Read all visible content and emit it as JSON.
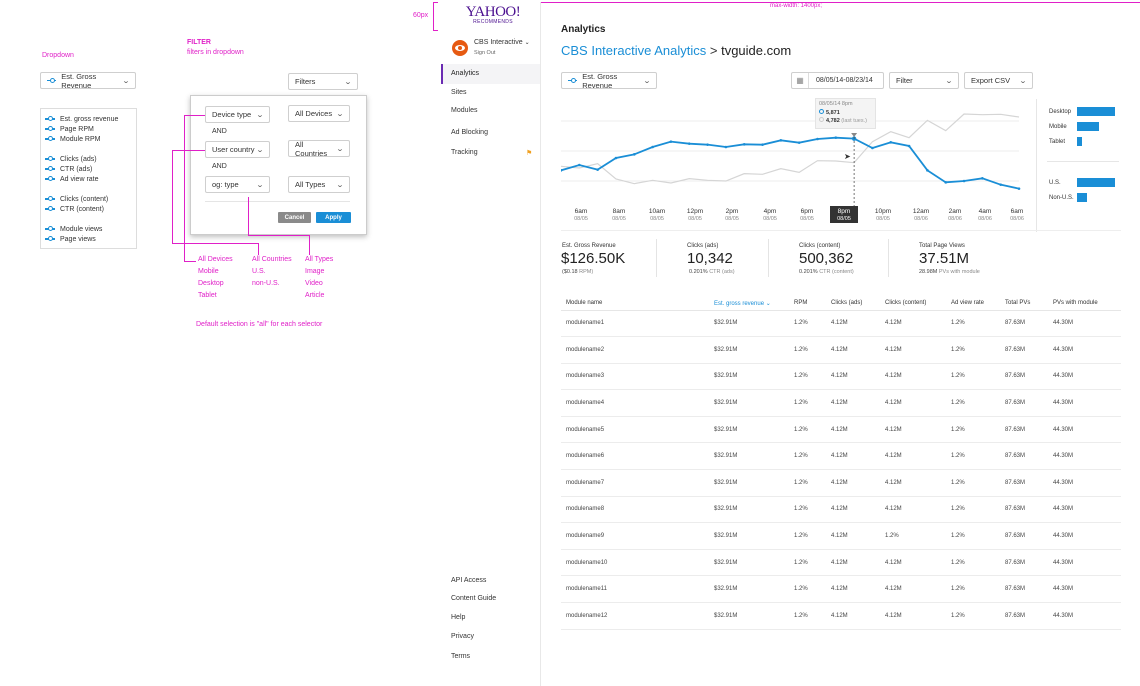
{
  "annotations": {
    "spec_px": "60px",
    "spec_maxwidth": "max-width: 1400px;",
    "dropdown_title": "Dropdown",
    "filter_title": "FILTER",
    "filter_subtitle": "filters in dropdown",
    "default_note": "Default selection is \"all\" for each selector",
    "device_options": [
      "All Devices",
      "Mobile",
      "Desktop",
      "Tablet"
    ],
    "country_options": [
      "All Countries",
      "U.S.",
      "non-U.S."
    ],
    "type_options": [
      "All Types",
      "Image",
      "Video",
      "Article"
    ]
  },
  "dropdown_demo": {
    "selected": "Est. Gross Revenue",
    "groups": [
      [
        "Est. gross revenue",
        "Page RPM",
        "Module RPM"
      ],
      [
        "Clicks (ads)",
        "CTR (ads)",
        "Ad view rate"
      ],
      [
        "Clicks (content)",
        "CTR (content)"
      ],
      [
        "Module views",
        "Page views"
      ]
    ]
  },
  "filter_demo": {
    "button": "Filters",
    "rows": [
      {
        "left": "Device type",
        "right": "All Devices"
      },
      {
        "left": "User country",
        "right": "All Countries"
      },
      {
        "left": "og: type",
        "right": "All Types"
      }
    ],
    "and_label": "AND",
    "cancel": "Cancel",
    "apply": "Apply"
  },
  "brand": {
    "logo": "YAHOO!",
    "sublogo": "RECOMMENDS"
  },
  "account": {
    "name": "CBS Interactive",
    "signout": "Sign Out"
  },
  "nav": {
    "items": [
      "Analytics",
      "Sites",
      "Modules",
      "Ad Blocking",
      "Tracking"
    ],
    "footer": [
      "API Access",
      "Content Guide",
      "Help",
      "Privacy",
      "Terms"
    ]
  },
  "page": {
    "heading": "Analytics",
    "crumb_link": "CBS Interactive Analytics",
    "crumb_sep": ">",
    "crumb_current": "tvguide.com"
  },
  "toolbar": {
    "metric": "Est. Gross Revenue",
    "date_range": "08/05/14-08/23/14",
    "filter": "Filter",
    "export": "Export CSV"
  },
  "tooltip": {
    "date": "08/05/14 8pm",
    "current": "5,871",
    "last": "4,782",
    "last_label": "(last tues.)"
  },
  "chart_data": {
    "type": "line",
    "x": [
      "6am 08/05",
      "8am 08/05",
      "10am 08/05",
      "12pm 08/05",
      "2pm 08/05",
      "4pm 08/05",
      "6pm 08/05",
      "8pm 08/05",
      "10pm 08/05",
      "12am 08/06",
      "2am 08/06",
      "4am 08/06",
      "6am 08/06"
    ],
    "tick_times": [
      "6am",
      "8am",
      "10am",
      "12pm",
      "2pm",
      "4pm",
      "6pm",
      "8pm",
      "10pm",
      "12am",
      "2am",
      "4am",
      "6am"
    ],
    "tick_dates": [
      "08/05",
      "08/05",
      "08/05",
      "08/05",
      "08/05",
      "08/05",
      "08/05",
      "08/05",
      "08/05",
      "08/06",
      "08/06",
      "08/06",
      "08/06"
    ],
    "series": [
      {
        "values": [
          4920,
          5080,
          4940,
          5290,
          5400,
          5620,
          5780,
          5720,
          5690,
          5620,
          5700,
          5690,
          5820,
          5750,
          5860,
          5900,
          5871,
          5590,
          5760,
          5650,
          4920,
          4560,
          4600,
          4680,
          4490,
          4370
        ],
        "color": "#1a8ed6"
      },
      {
        "values": [
          5040,
          4990,
          5120,
          4660,
          4520,
          4620,
          4540,
          4670,
          4620,
          4600,
          4820,
          4800,
          4970,
          4860,
          5210,
          5200,
          5150,
          5780,
          6080,
          5900,
          6420,
          6110,
          6610,
          6590,
          6600,
          6520
        ],
        "color": "#d5d5d5"
      }
    ],
    "ylim": [
      4000,
      7000
    ],
    "highlight_index": 16
  },
  "breakdown": {
    "devices": [
      {
        "label": "Desktop",
        "value": 0.85
      },
      {
        "label": "Mobile",
        "value": 0.48
      },
      {
        "label": "Tablet",
        "value": 0.12
      }
    ],
    "regions": [
      {
        "label": "U.S.",
        "value": 0.85
      },
      {
        "label": "Non-U.S.",
        "value": 0.22
      }
    ]
  },
  "kpis": [
    {
      "label": "Est. Gross Revenue",
      "value": "$126.50K",
      "sub_value": "($0.18",
      "sub_unit": "RPM)"
    },
    {
      "label": "Clicks (ads)",
      "value": "10,342",
      "sub_value": "0.201%",
      "sub_unit": "CTR (ads)"
    },
    {
      "label": "Clicks (content)",
      "value": "500,362",
      "sub_value": "0.201%",
      "sub_unit": "CTR (content)"
    },
    {
      "label": "Total Page Views",
      "value": "37.51M",
      "sub_value": "28.98M",
      "sub_unit": "PVs with module"
    }
  ],
  "table": {
    "headers": [
      "Module name",
      "Est. gross revenue",
      "RPM",
      "Clicks (ads)",
      "Clicks (content)",
      "Ad view rate",
      "Total PVs",
      "PVs with module"
    ],
    "rows": [
      [
        "modulename1",
        "$32.91M",
        "1.2%",
        "4.12M",
        "4.12M",
        "1.2%",
        "87.63M",
        "44.30M"
      ],
      [
        "modulename2",
        "$32.91M",
        "1.2%",
        "4.12M",
        "4.12M",
        "1.2%",
        "87.63M",
        "44.30M"
      ],
      [
        "modulename3",
        "$32.91M",
        "1.2%",
        "4.12M",
        "4.12M",
        "1.2%",
        "87.63M",
        "44.30M"
      ],
      [
        "modulename4",
        "$32.91M",
        "1.2%",
        "4.12M",
        "4.12M",
        "1.2%",
        "87.63M",
        "44.30M"
      ],
      [
        "modulename5",
        "$32.91M",
        "1.2%",
        "4.12M",
        "4.12M",
        "1.2%",
        "87.63M",
        "44.30M"
      ],
      [
        "modulename6",
        "$32.91M",
        "1.2%",
        "4.12M",
        "4.12M",
        "1.2%",
        "87.63M",
        "44.30M"
      ],
      [
        "modulename7",
        "$32.91M",
        "1.2%",
        "4.12M",
        "4.12M",
        "1.2%",
        "87.63M",
        "44.30M"
      ],
      [
        "modulename8",
        "$32.91M",
        "1.2%",
        "4.12M",
        "4.12M",
        "1.2%",
        "87.63M",
        "44.30M"
      ],
      [
        "modulename9",
        "$32.91M",
        "1.2%",
        "4.12M",
        "1.2%",
        "1.2%",
        "87.63M",
        "44.30M"
      ],
      [
        "modulename10",
        "$32.91M",
        "1.2%",
        "4.12M",
        "4.12M",
        "1.2%",
        "87.63M",
        "44.30M"
      ],
      [
        "modulename11",
        "$32.91M",
        "1.2%",
        "4.12M",
        "4.12M",
        "1.2%",
        "87.63M",
        "44.30M"
      ],
      [
        "modulename12",
        "$32.91M",
        "1.2%",
        "4.12M",
        "4.12M",
        "1.2%",
        "87.63M",
        "44.30M"
      ]
    ]
  }
}
